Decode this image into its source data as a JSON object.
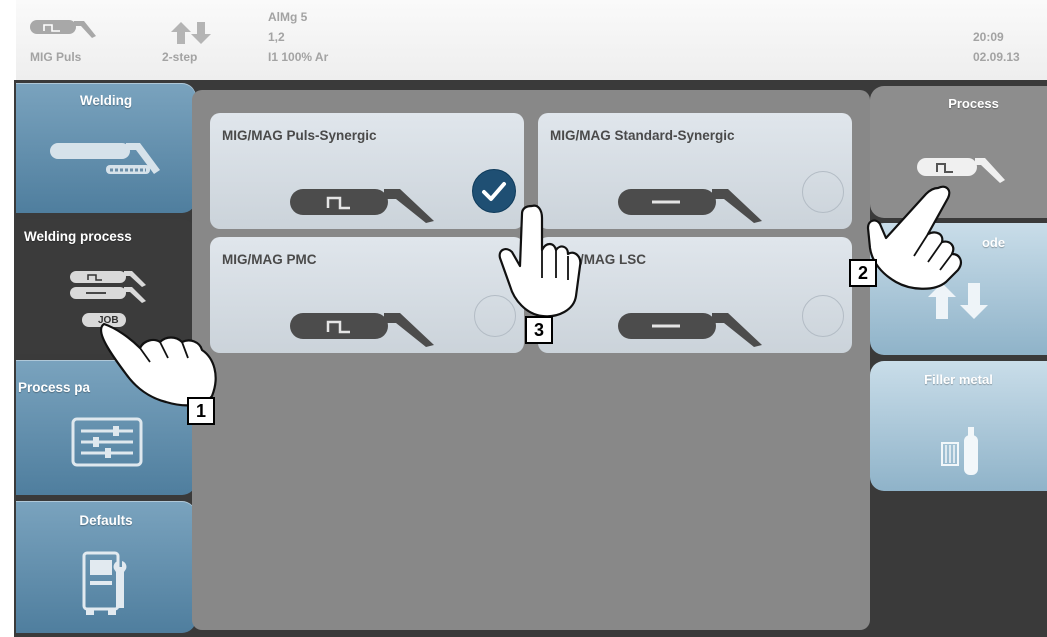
{
  "status_bar": {
    "process": "MIG Puls",
    "mode": "2-step",
    "material": "AlMg 5",
    "wire_diameter": "1,2",
    "gas": "I1 100% Ar",
    "time": "20:09",
    "date": "02.09.13"
  },
  "left_tabs": [
    {
      "label": "Welding",
      "icon": "torch-icon",
      "active": false
    },
    {
      "label": "Welding process",
      "icon": "process-job-icon",
      "active": true,
      "job_label": "JOB"
    },
    {
      "label": "Process pa",
      "icon": "sliders-icon",
      "active": false
    },
    {
      "label": "Defaults",
      "icon": "machine-wrench-icon",
      "active": false
    }
  ],
  "process_cards": [
    {
      "label": "MIG/MAG Puls-Synergic",
      "selected": true
    },
    {
      "label": "MIG/MAG Standard-Synergic",
      "selected": false
    },
    {
      "label": "MIG/MAG PMC",
      "selected": false
    },
    {
      "label": "/MAG LSC",
      "selected": false
    }
  ],
  "right_tabs": [
    {
      "label": "Process",
      "icon": "pulse-torch-icon",
      "active": true
    },
    {
      "label": "ode",
      "icon": "mode-arrows-icon",
      "active": false
    },
    {
      "label": "Filler metal",
      "icon": "filler-wire-gas-icon",
      "active": false
    }
  ],
  "callouts": [
    "1",
    "2",
    "3"
  ],
  "colors": {
    "tab_blue": "#5e8aa8",
    "tab_light_blue": "#a9c7d9",
    "check_blue": "#1f4f73",
    "frame_dark": "#3a3a3a",
    "content_grey": "#888888"
  }
}
